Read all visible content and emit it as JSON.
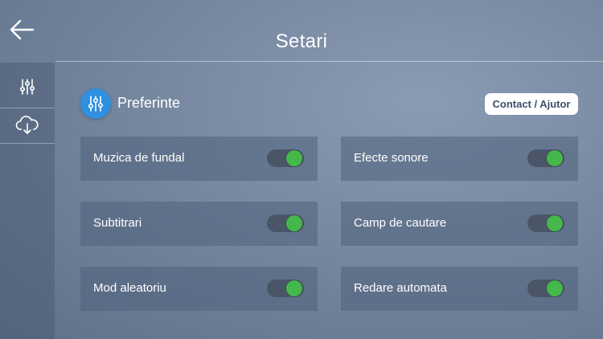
{
  "header": {
    "title": "Setari",
    "back_icon": "arrow-left-icon"
  },
  "sidebar": {
    "items": [
      {
        "icon": "sliders-icon",
        "selected": true
      },
      {
        "icon": "cloud-download-icon",
        "selected": false
      }
    ]
  },
  "section": {
    "title": "Preferinte",
    "icon": "sliders-icon",
    "icon_color": "#2f8fe0",
    "contact_label": "Contact / Ajutor"
  },
  "settings": [
    {
      "label": "Muzica de fundal",
      "enabled": true
    },
    {
      "label": "Efecte sonore",
      "enabled": true
    },
    {
      "label": "Subtitrari",
      "enabled": true
    },
    {
      "label": "Camp de cautare",
      "enabled": true
    },
    {
      "label": "Mod aleatoriu",
      "enabled": true
    },
    {
      "label": "Redare automata",
      "enabled": true
    }
  ],
  "colors": {
    "toggle_on": "#44b84a",
    "toggle_track": "#4a5668"
  }
}
